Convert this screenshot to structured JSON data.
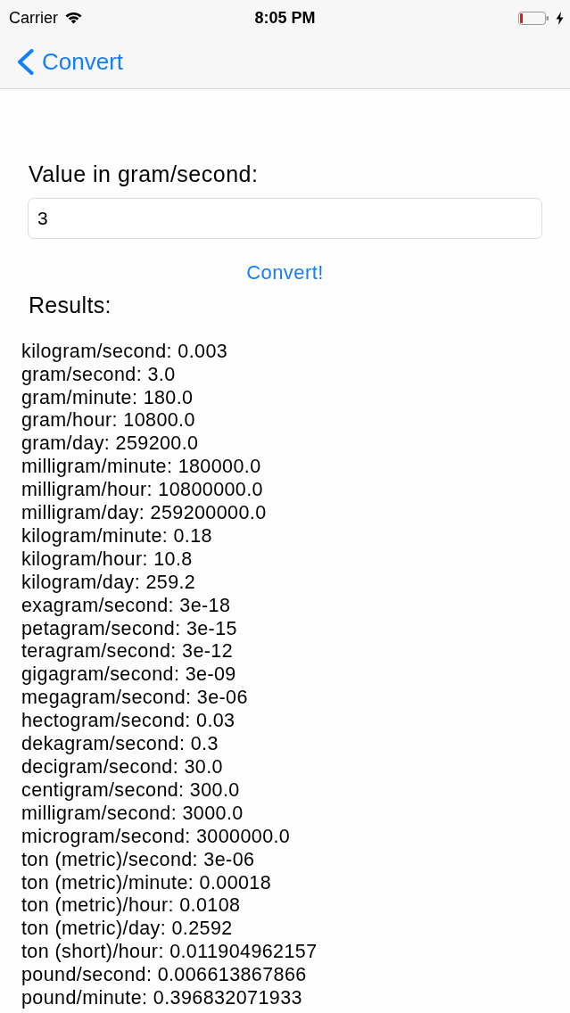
{
  "status_bar": {
    "carrier": "Carrier",
    "time": "8:05 PM"
  },
  "nav_bar": {
    "back_label": "Convert"
  },
  "form": {
    "label": "Value in gram/second:",
    "value": "3",
    "button": "Convert!"
  },
  "results": {
    "heading": "Results:",
    "lines": [
      "kilogram/second: 0.003",
      "gram/second: 3.0",
      "gram/minute: 180.0",
      "gram/hour: 10800.0",
      "gram/day: 259200.0",
      "milligram/minute: 180000.0",
      "milligram/hour: 10800000.0",
      "milligram/day: 259200000.0",
      "kilogram/minute: 0.18",
      "kilogram/hour: 10.8",
      "kilogram/day: 259.2",
      "exagram/second: 3e-18",
      "petagram/second: 3e-15",
      "teragram/second: 3e-12",
      "gigagram/second: 3e-09",
      "megagram/second: 3e-06",
      "hectogram/second: 0.03",
      "dekagram/second: 0.3",
      "decigram/second: 30.0",
      "centigram/second: 300.0",
      "milligram/second: 3000.0",
      "microgram/second: 3000000.0",
      "ton (metric)/second: 3e-06",
      "ton (metric)/minute: 0.00018",
      "ton (metric)/hour: 0.0108",
      "ton (metric)/day: 0.2592",
      "ton (short)/hour: 0.011904962157",
      "pound/second: 0.006613867866",
      "pound/minute: 0.396832071933"
    ]
  }
}
